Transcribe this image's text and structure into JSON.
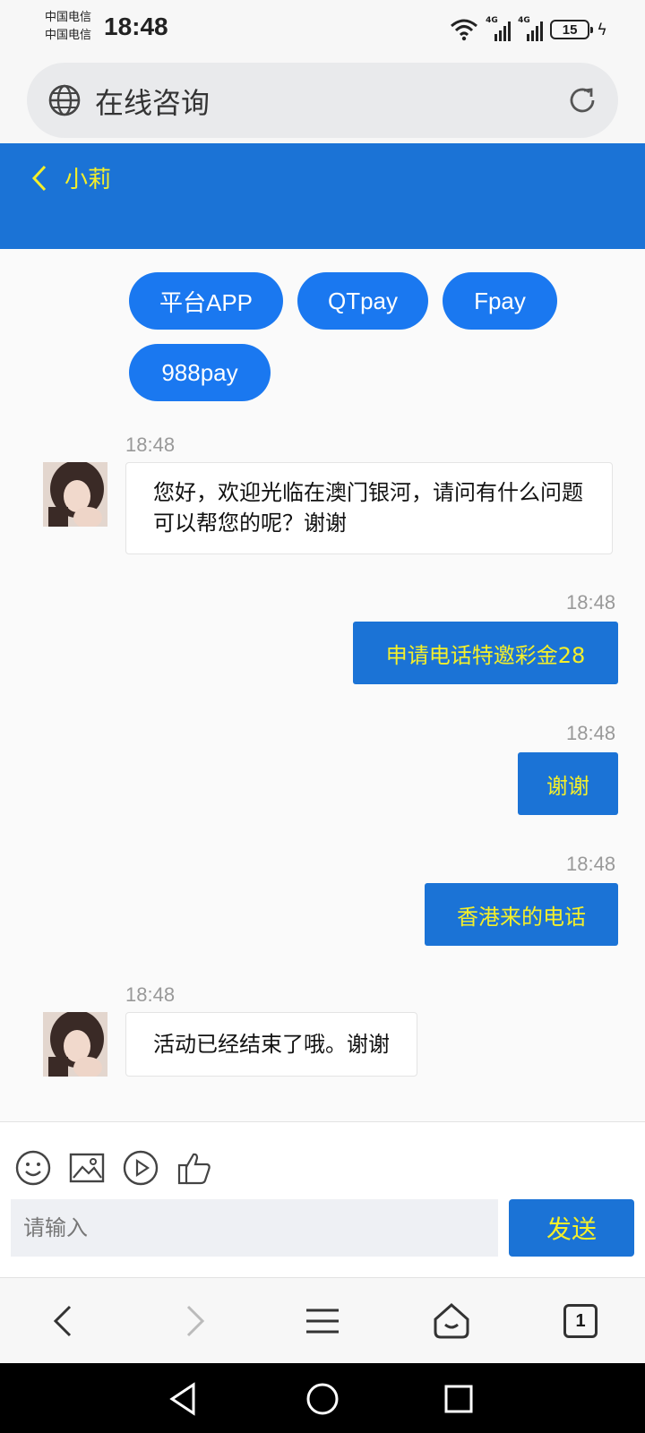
{
  "status_bar": {
    "carrier_1": "中国电信",
    "carrier_2": "中国电信",
    "time": "18:48",
    "signal_1": "4G",
    "signal_2": "4G",
    "battery": "15"
  },
  "browser": {
    "title": "在线咨询"
  },
  "chat_header": {
    "agent_name": "小莉"
  },
  "quick_replies": [
    "平台APP",
    "QTpay",
    "Fpay",
    "988pay"
  ],
  "messages": [
    {
      "from": "agent",
      "time": "18:48",
      "text": "您好，欢迎光临在澳门银河，请问有什么问题可以帮您的呢？谢谢"
    },
    {
      "from": "user",
      "time": "18:48",
      "text": "申请电话特邀彩金28"
    },
    {
      "from": "user",
      "time": "18:48",
      "text": "谢谢"
    },
    {
      "from": "user",
      "time": "18:48",
      "text": "香港来的电话"
    },
    {
      "from": "agent",
      "time": "18:48",
      "text": "活动已经结束了哦。谢谢"
    }
  ],
  "composer": {
    "placeholder": "请输入",
    "send_label": "发送",
    "tools": [
      "emoji-icon",
      "image-icon",
      "video-icon",
      "thumbs-up-icon"
    ]
  },
  "browser_nav": {
    "tab_count": "1"
  },
  "colors": {
    "header_blue": "#1b73d6",
    "quick_reply_blue": "#1a78f0",
    "accent_yellow": "#f4ef2a"
  }
}
